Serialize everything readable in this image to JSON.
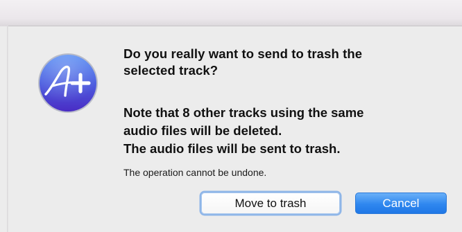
{
  "dialog": {
    "app_icon": "a-plus-app-icon",
    "message_line1": "Do you really want to send to trash the",
    "message_line2": "selected track?",
    "note_line1": "Note that 8 other tracks using the same",
    "note_line2": "audio files will be deleted.",
    "note_line3": "The audio files will be sent to trash.",
    "informative_text": "The operation cannot be undone.",
    "buttons": {
      "move_to_trash": "Move to trash",
      "cancel": "Cancel"
    },
    "colors": {
      "icon_gradient_top": "#4f7ff0",
      "icon_gradient_bottom": "#4a2fc8",
      "default_button": "#2f87ef",
      "focus_ring": "#8fb6e8"
    }
  }
}
